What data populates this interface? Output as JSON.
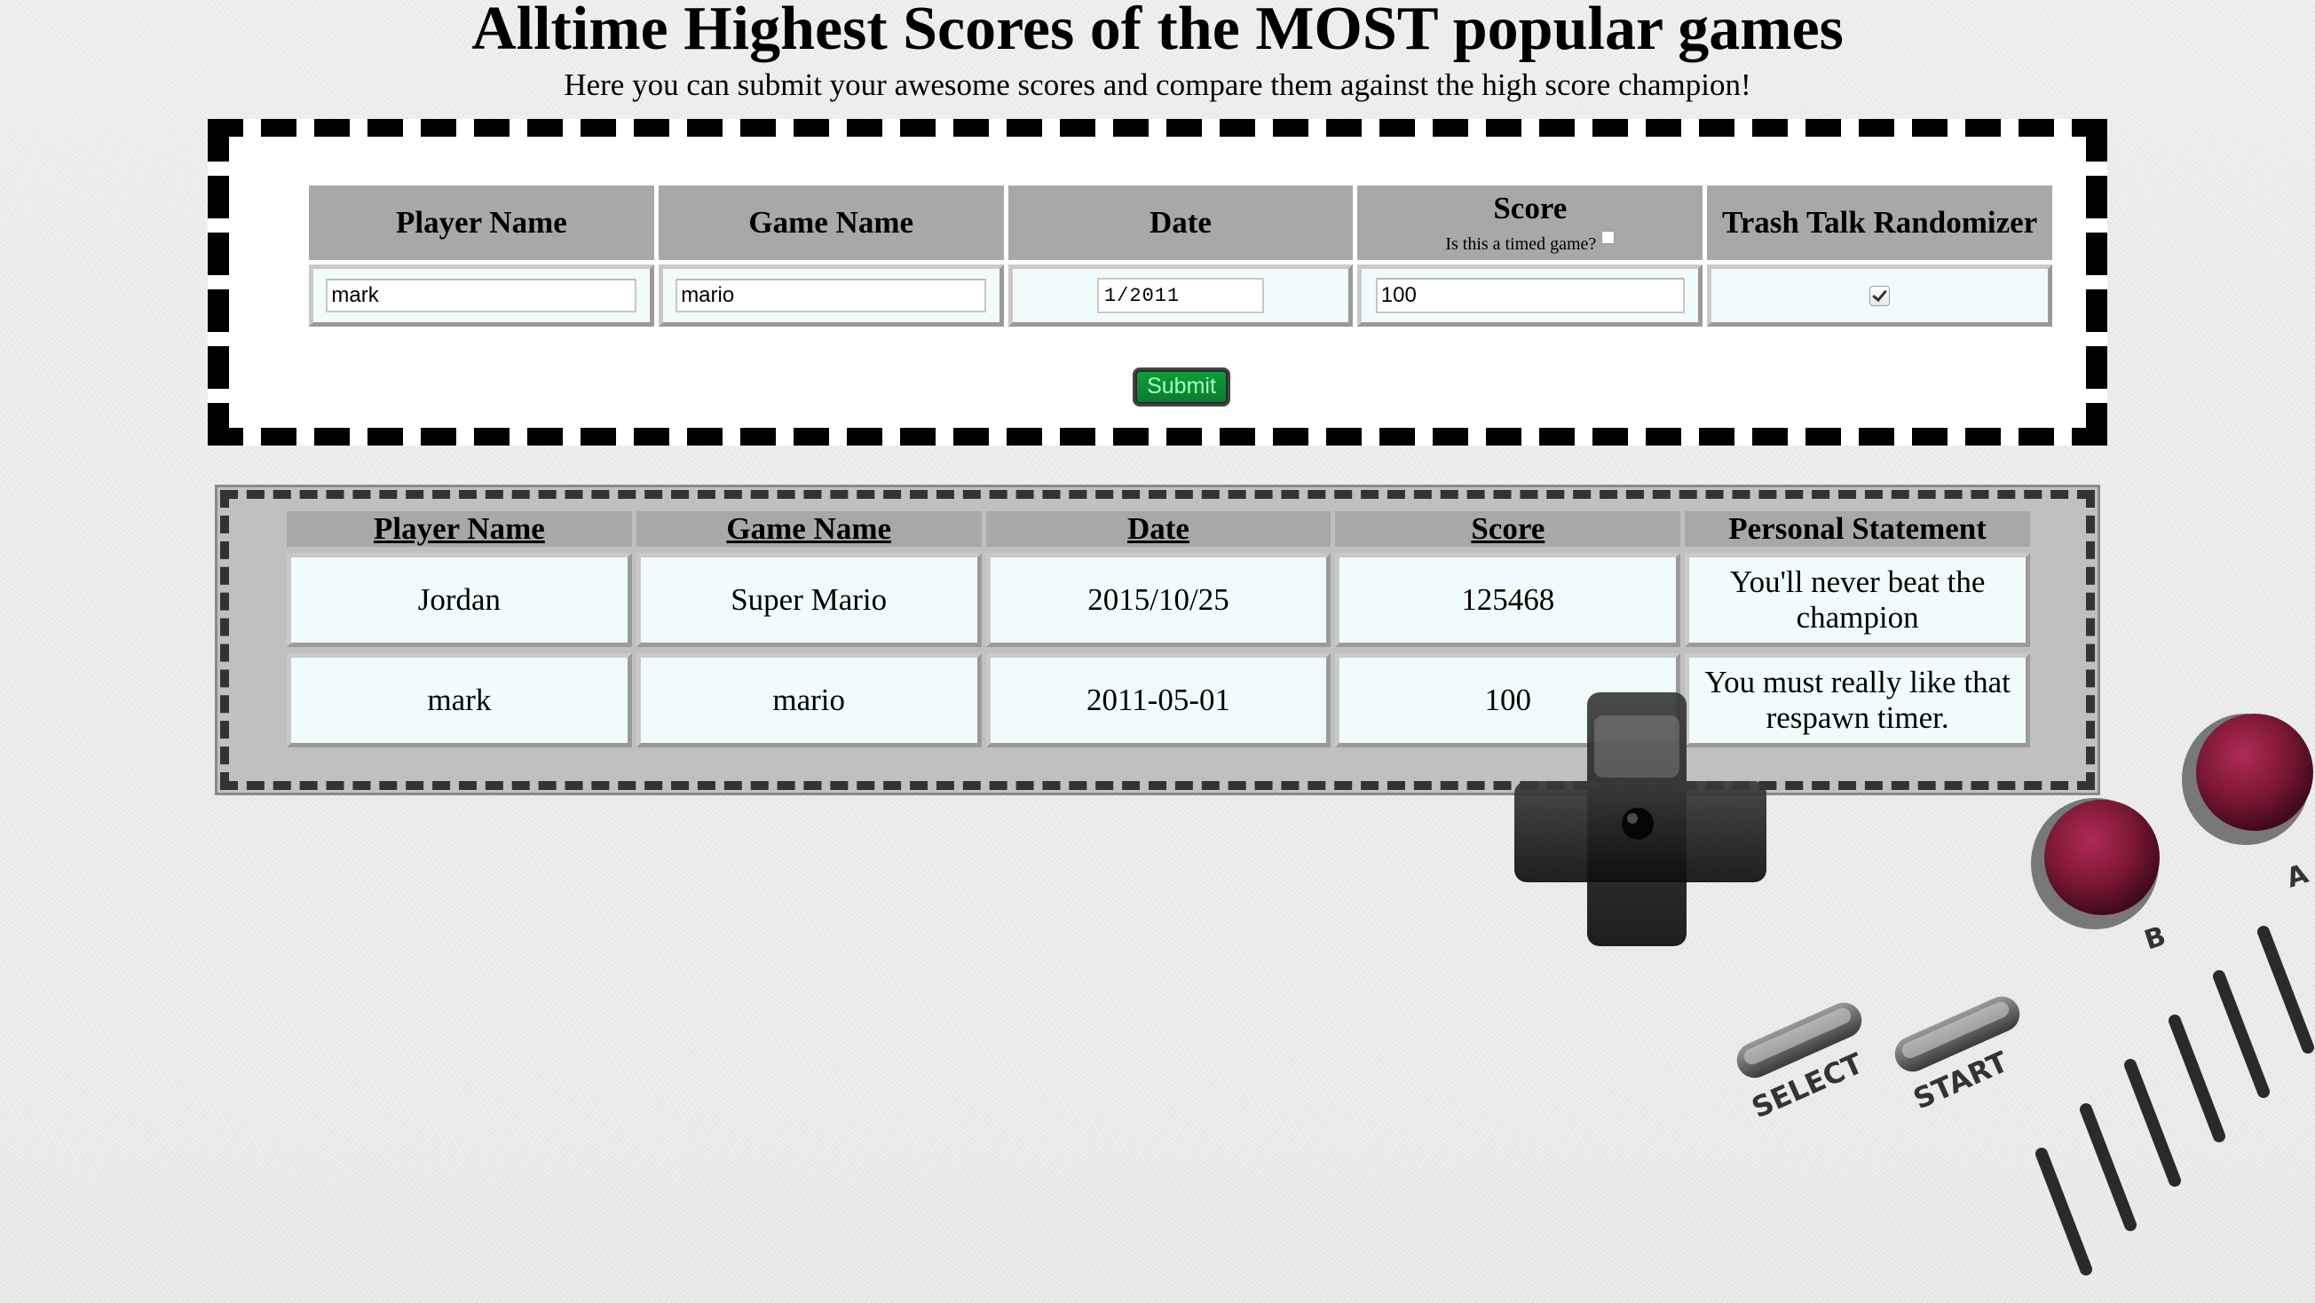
{
  "header": {
    "title": "Alltime Highest Scores of the MOST popular games",
    "subtitle": "Here you can submit your awesome scores and compare them against the high score champion!"
  },
  "form": {
    "columns": {
      "player_name": "Player Name",
      "game_name": "Game Name",
      "date": "Date",
      "score": "Score",
      "score_note": "Is this a timed game?",
      "trash_talk": "Trash Talk Randomizer"
    },
    "values": {
      "player_name": "mark",
      "game_name": "mario",
      "date": "1/2011",
      "score": "100",
      "timed_game": false,
      "trash_talk": true
    },
    "submit_label": "Submit"
  },
  "scores": {
    "columns": {
      "player_name": "Player Name",
      "game_name": "Game Name",
      "date": "Date",
      "score": "Score",
      "statement": "Personal Statement"
    },
    "rows": [
      {
        "player_name": "Jordan",
        "game_name": "Super Mario",
        "date": "2015/10/25",
        "score": "125468",
        "statement": "You'll never beat the champion"
      },
      {
        "player_name": "mark",
        "game_name": "mario",
        "date": "2011-05-01",
        "score": "100",
        "statement": "You must really like that respawn timer."
      }
    ]
  },
  "decoration": {
    "button_a": "A",
    "button_b": "B",
    "select": "SELECT",
    "start": "START"
  },
  "colors": {
    "header_cell": "#a8a8a8",
    "data_cell": "#f0fbfb",
    "submit_green": "#0a7a2e",
    "gameboy_button": "#7a1735"
  }
}
